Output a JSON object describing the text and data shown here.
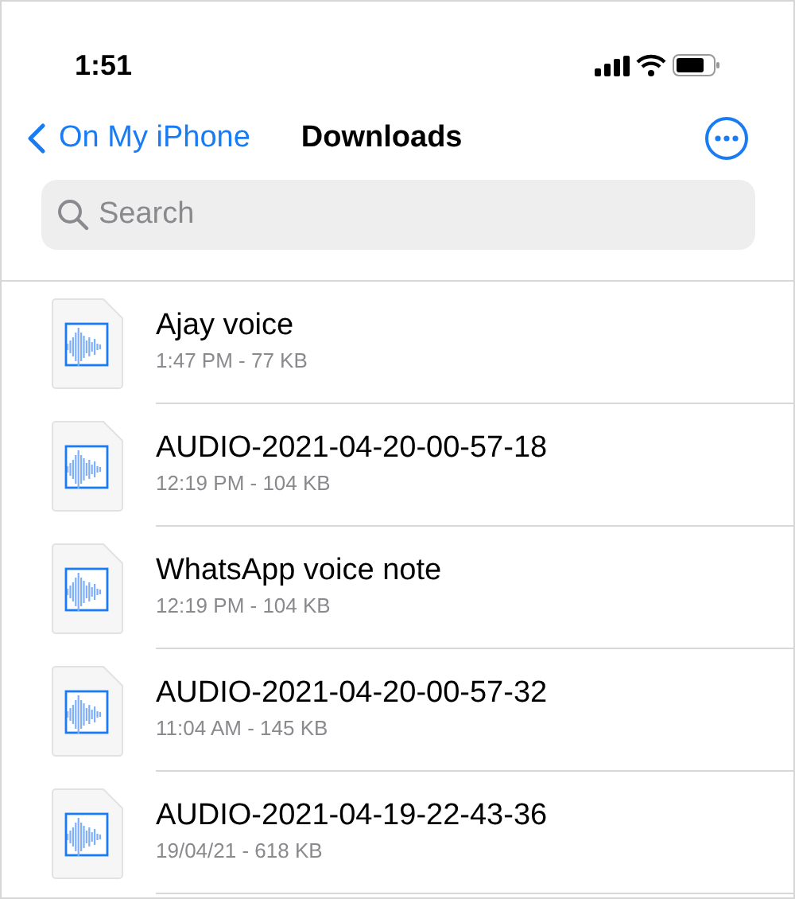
{
  "status_bar": {
    "time": "1:51"
  },
  "nav": {
    "back_label": "On My iPhone",
    "title": "Downloads"
  },
  "search": {
    "placeholder": "Search"
  },
  "files": [
    {
      "name": "Ajay voice",
      "details": "1:47 PM - 77 KB"
    },
    {
      "name": "AUDIO-2021-04-20-00-57-18",
      "details": "12:19 PM - 104 KB"
    },
    {
      "name": "WhatsApp voice note",
      "details": "12:19 PM - 104 KB"
    },
    {
      "name": "AUDIO-2021-04-20-00-57-32",
      "details": "11:04 AM - 145 KB"
    },
    {
      "name": "AUDIO-2021-04-19-22-43-36",
      "details": "19/04/21 - 618 KB"
    }
  ]
}
